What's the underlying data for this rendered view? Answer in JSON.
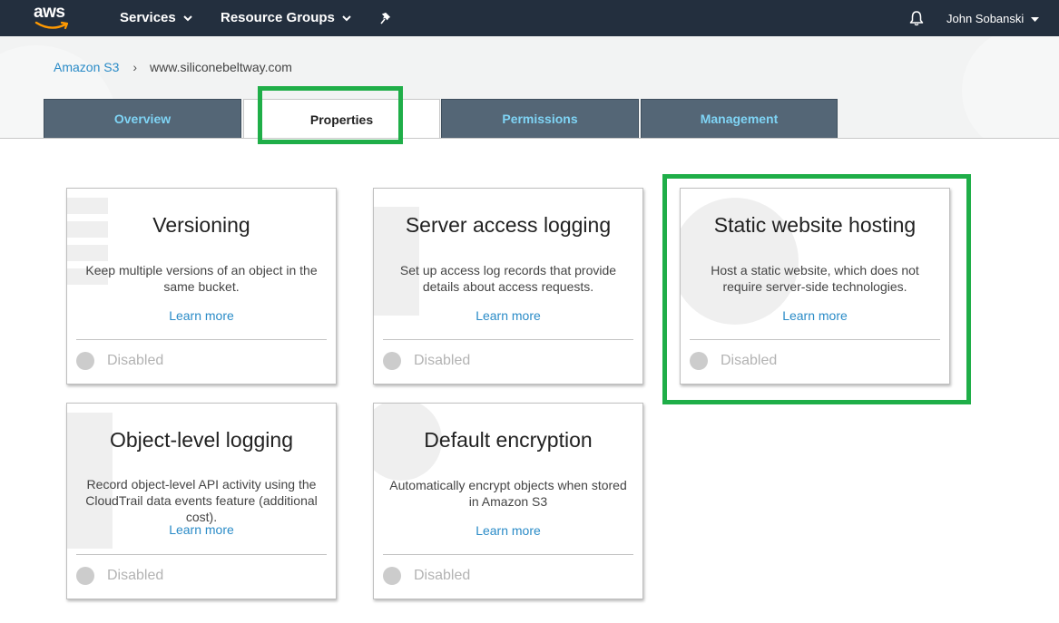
{
  "topbar": {
    "logo_text": "aws",
    "services_label": "Services",
    "resource_groups_label": "Resource Groups",
    "user_name": "John Sobanski"
  },
  "breadcrumb": {
    "root": "Amazon S3",
    "separator": "›",
    "current": "www.siliconebeltway.com"
  },
  "tabs": [
    {
      "label": "Overview"
    },
    {
      "label": "Properties"
    },
    {
      "label": "Permissions"
    },
    {
      "label": "Management"
    }
  ],
  "cards": [
    {
      "title": "Versioning",
      "description": "Keep multiple versions of an object in the same bucket.",
      "link": "Learn more",
      "status": "Disabled",
      "icon": "layers-icon"
    },
    {
      "title": "Server access logging",
      "description": "Set up access log records that provide details about access requests.",
      "link": "Learn more",
      "status": "Disabled",
      "icon": "log-icon"
    },
    {
      "title": "Static website hosting",
      "description": "Host a static website, which does not require server-side technologies.",
      "link": "Learn more",
      "status": "Disabled",
      "icon": "globe-icon"
    },
    {
      "title": "Object-level logging",
      "description": "Record object-level API activity using the CloudTrail data events feature (additional cost).",
      "link": "Learn more",
      "status": "Disabled",
      "icon": "log-icon"
    },
    {
      "title": "Default encryption",
      "description": "Automatically encrypt objects when stored in Amazon S3",
      "link": "Learn more",
      "status": "Disabled",
      "icon": "lock-icon"
    }
  ],
  "colors": {
    "nav_background": "#232f3e",
    "tab_inactive": "#546676",
    "tab_inactive_text": "#7fd4f5",
    "link": "#2a8bc7",
    "highlight": "#1fae48",
    "toggle_off": "#cccccc"
  }
}
